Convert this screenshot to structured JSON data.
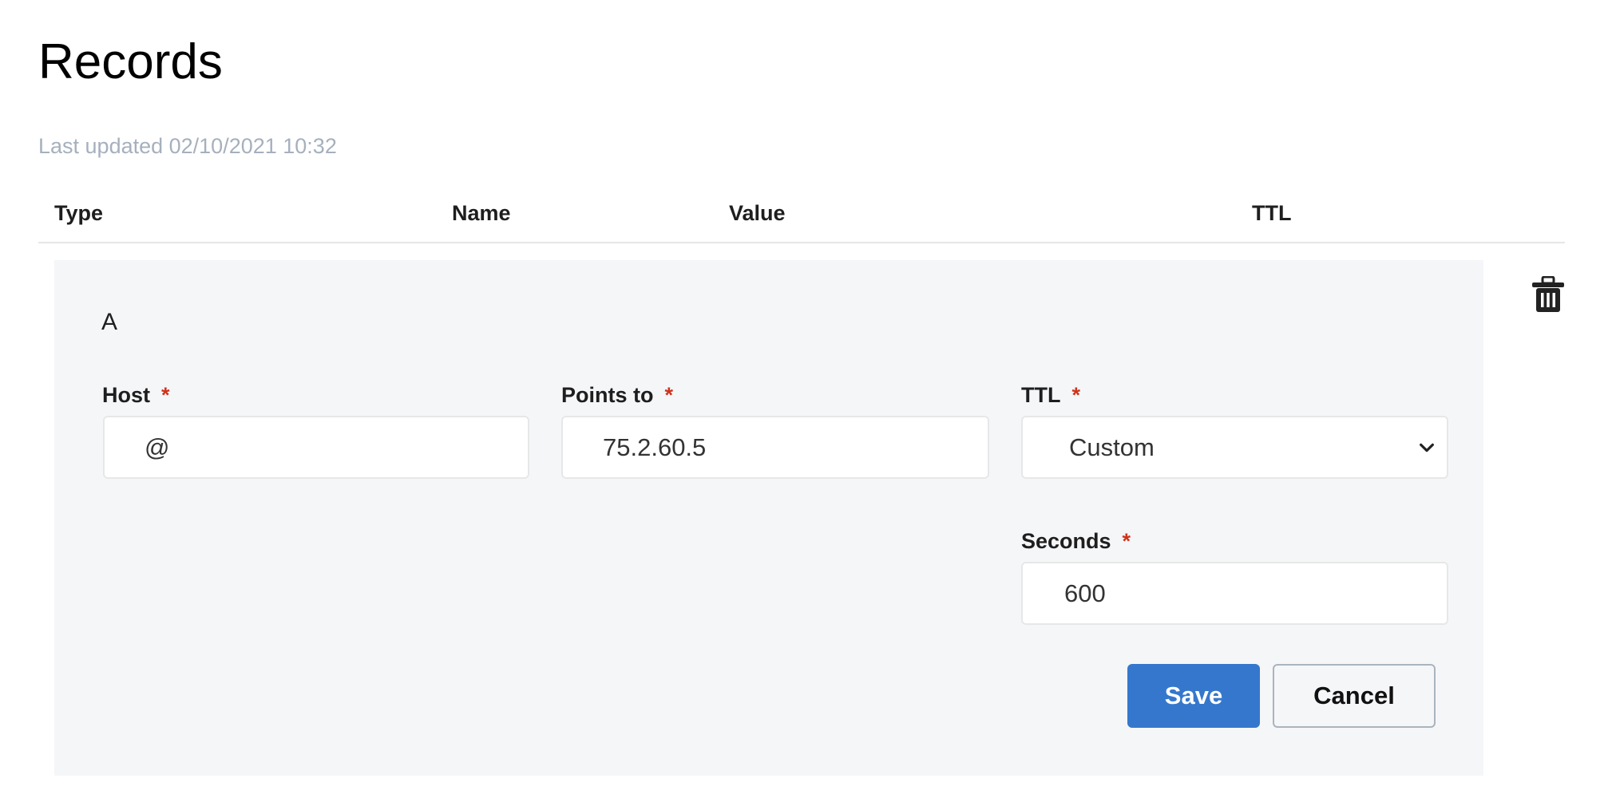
{
  "page": {
    "title": "Records",
    "last_updated": "Last updated 02/10/2021 10:32"
  },
  "table": {
    "columns": [
      "Type",
      "Name",
      "Value",
      "TTL"
    ]
  },
  "record": {
    "type": "A",
    "fields": {
      "host": {
        "label": "Host",
        "required_mark": "*",
        "value": "@"
      },
      "points_to": {
        "label": "Points to",
        "required_mark": "*",
        "value": "75.2.60.5"
      },
      "ttl": {
        "label": "TTL",
        "required_mark": "*",
        "selected": "Custom"
      },
      "seconds": {
        "label": "Seconds",
        "required_mark": "*",
        "value": "600"
      }
    },
    "actions": {
      "save_label": "Save",
      "cancel_label": "Cancel",
      "delete_icon": "trash-icon"
    }
  },
  "colors": {
    "primary": "#3577cd",
    "required": "#d0321a",
    "panel_bg": "#f5f6f8",
    "muted_text": "#a6b0bd"
  }
}
